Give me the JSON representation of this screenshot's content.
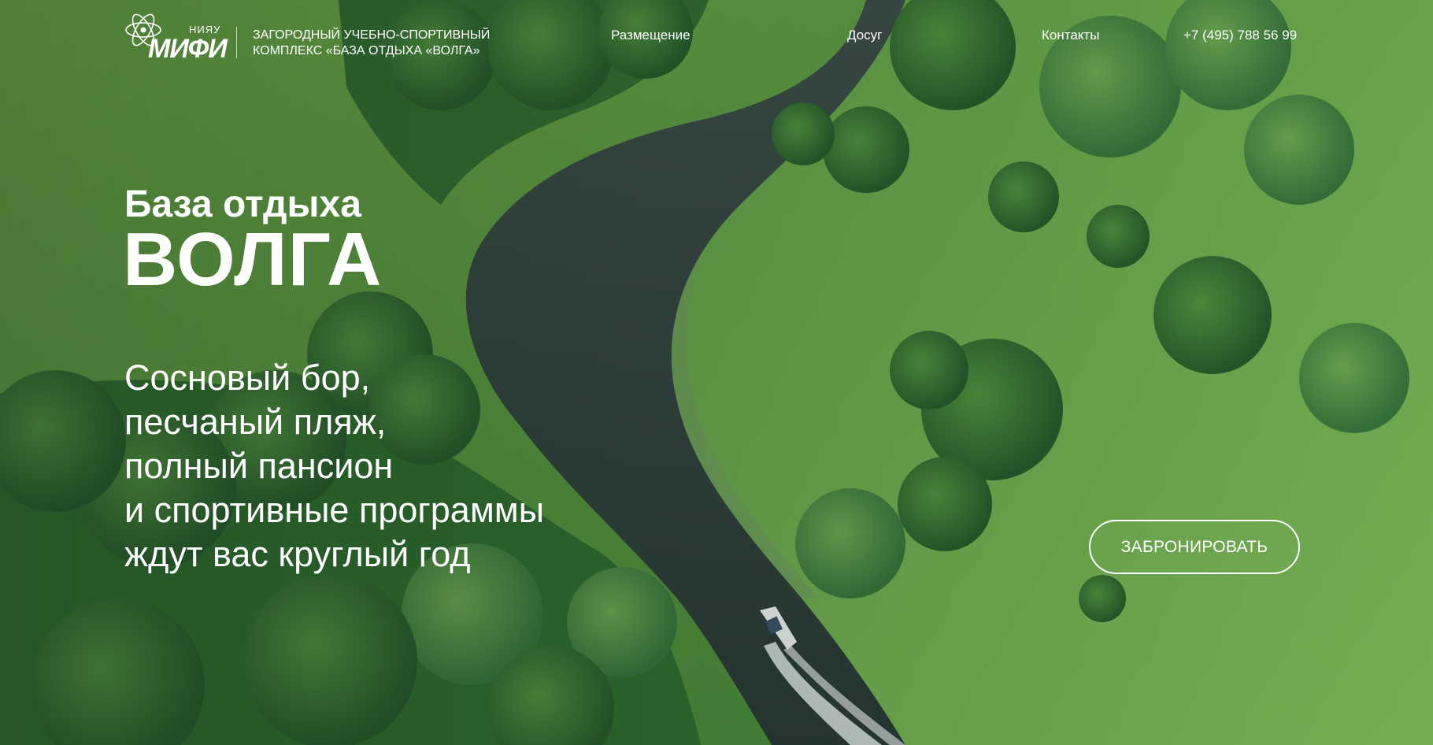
{
  "header": {
    "logo": {
      "top_text": "НИЯУ",
      "main_text": "МИФИ"
    },
    "tagline_line1": "ЗАГОРОДНЫЙ УЧЕБНО-СПОРТИВНЫЙ",
    "tagline_line2": "КОМПЛЕКС «БАЗА ОТДЫХА «ВОЛГА»",
    "nav": [
      "Размещение",
      "Досуг",
      "Контакты"
    ],
    "phone": "+7 (495) 788 56 99"
  },
  "hero": {
    "title_small": "База отдыха",
    "title_big": "ВОЛГА",
    "lead_lines": [
      "Сосновый бор,",
      "песчаный пляж,",
      "полный пансион",
      "и спортивные программы",
      "ждут вас круглый год"
    ],
    "cta_label": "ЗАБРОНИРОВАТЬ",
    "background": "aerial-river-forest-photo"
  },
  "colors": {
    "text": "#ffffff",
    "meadow": "#6fa84a",
    "forest": "#2f6b2c",
    "river": "#2e3d3a"
  }
}
